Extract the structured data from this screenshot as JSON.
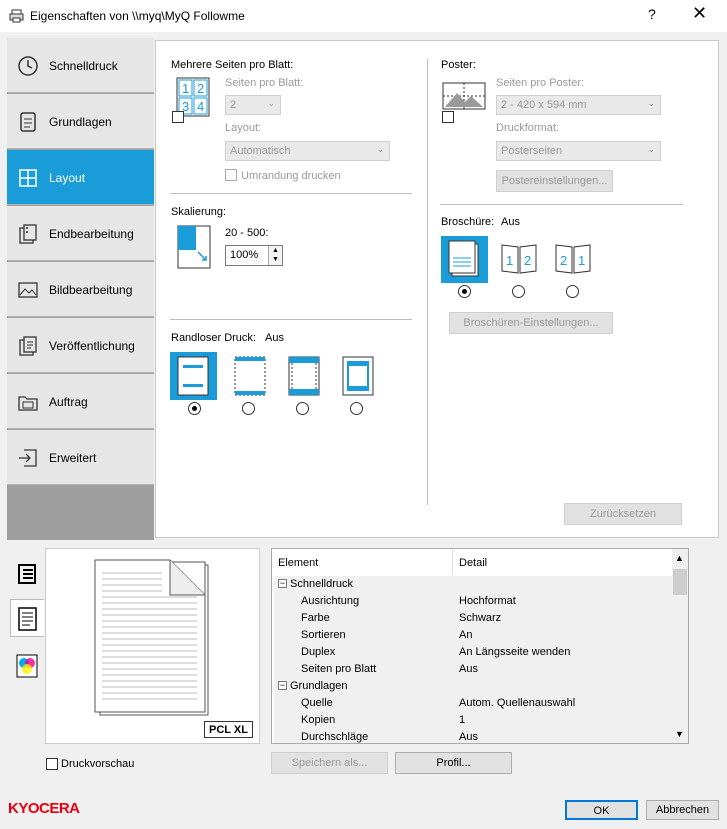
{
  "window": {
    "title": "Eigenschaften von \\\\myq\\MyQ Followme",
    "help": "?",
    "close": "✕"
  },
  "sidebar": {
    "items": [
      {
        "label": "Schnelldruck",
        "icon": "clock-icon"
      },
      {
        "label": "Grundlagen",
        "icon": "document-icon"
      },
      {
        "label": "Layout",
        "icon": "layout-grid-icon"
      },
      {
        "label": "Endbearbeitung",
        "icon": "finishing-icon"
      },
      {
        "label": "Bildbearbeitung",
        "icon": "image-icon"
      },
      {
        "label": "Veröffentlichung",
        "icon": "publishing-icon"
      },
      {
        "label": "Auftrag",
        "icon": "job-icon"
      },
      {
        "label": "Erweitert",
        "icon": "advanced-icon"
      }
    ],
    "active": "Layout"
  },
  "layout": {
    "multi": {
      "title": "Mehrere Seiten pro Blatt:",
      "pages_label": "Seiten pro Blatt:",
      "pages_value": "2",
      "layout_label": "Layout:",
      "layout_value": "Automatisch",
      "border_label": "Umrandung drucken"
    },
    "scale": {
      "title": "Skalierung:",
      "range": "20 - 500:",
      "value": "100%"
    },
    "borderless": {
      "title": "Randloser Druck:",
      "value": "Aus"
    },
    "poster": {
      "title": "Poster:",
      "pages_label": "Seiten pro Poster:",
      "pages_value": "2 - 420 x 594 mm",
      "format_label": "Druckformat:",
      "format_value": "Posterseiten",
      "settings_button": "Postereinstellungen..."
    },
    "booklet": {
      "title": "Broschüre:",
      "value": "Aus",
      "settings_button": "Broschüren-Einstellungen..."
    },
    "reset_button": "Zurücksetzen"
  },
  "preview": {
    "badge": "PCL XL",
    "checkbox": "Druckvorschau"
  },
  "table": {
    "headers": [
      "Element",
      "Detail"
    ],
    "rows": [
      {
        "group": "Schnelldruck"
      },
      {
        "k": "Ausrichtung",
        "v": "Hochformat"
      },
      {
        "k": "Farbe",
        "v": "Schwarz"
      },
      {
        "k": "Sortieren",
        "v": "An"
      },
      {
        "k": "Duplex",
        "v": "An Längsseite wenden"
      },
      {
        "k": "Seiten pro Blatt",
        "v": "Aus"
      },
      {
        "group": "Grundlagen"
      },
      {
        "k": "Quelle",
        "v": "Autom. Quellenauswahl"
      },
      {
        "k": "Kopien",
        "v": "1"
      },
      {
        "k": "Durchschläge",
        "v": "Aus"
      }
    ]
  },
  "buttons": {
    "save_as": "Speichern als...",
    "profile": "Profil...",
    "ok": "OK",
    "cancel": "Abbrechen"
  },
  "brand": {
    "name": "KYOCERA",
    "color": "#e60012"
  },
  "colors": {
    "accent": "#1a9cd9"
  }
}
